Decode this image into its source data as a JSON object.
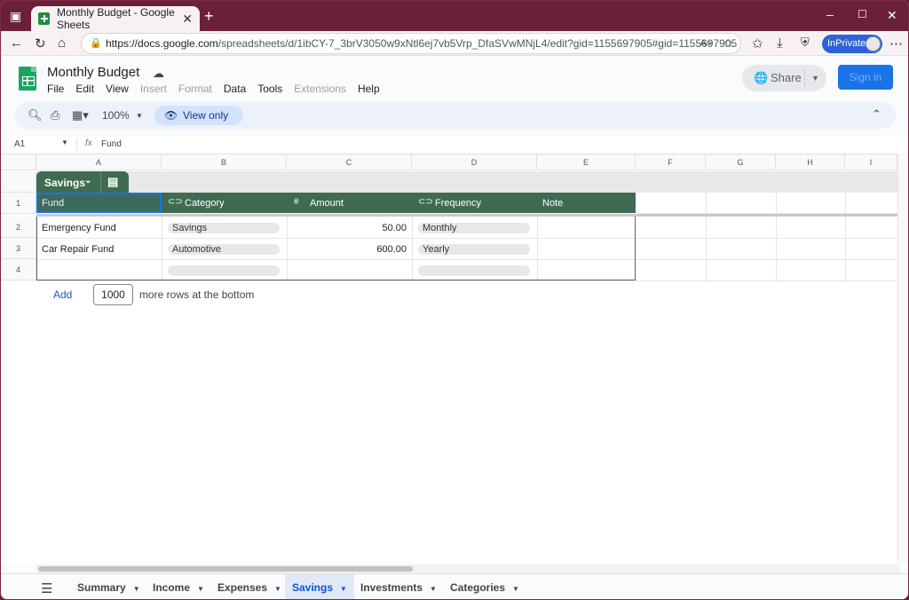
{
  "browser": {
    "tab_title": "Monthly Budget - Google Sheets",
    "url_host": "https://docs.google.com",
    "url_path": "/spreadsheets/d/1ibCY-7_3brV3050w9xNtl6ej7vb5Vrp_DfaSVwMNjL4/edit?gid=1155697905#gid=1155697905",
    "inprivate_label": "InPrivate"
  },
  "doc": {
    "title": "Monthly Budget",
    "menu": [
      "File",
      "Edit",
      "View",
      "Insert",
      "Format",
      "Data",
      "Tools",
      "Extensions",
      "Help"
    ],
    "share_label": "Share",
    "signin_label": "Sign in"
  },
  "toolbar": {
    "zoom": "100%",
    "view_only_label": "View only"
  },
  "formula_bar": {
    "name_box": "A1",
    "fx": "fx",
    "value": "Fund"
  },
  "grid": {
    "columns": [
      "A",
      "B",
      "C",
      "D",
      "E",
      "F",
      "G",
      "H",
      "I"
    ],
    "rows": [
      "1",
      "2",
      "3",
      "4"
    ],
    "table_name": "Savings",
    "headers": [
      "Fund",
      "Category",
      "Amount",
      "Frequency",
      "Note"
    ],
    "data": [
      {
        "fund": "Emergency Fund",
        "category": "Savings",
        "amount": "50.00",
        "frequency": "Monthly",
        "note": ""
      },
      {
        "fund": "Car Repair Fund",
        "category": "Automotive",
        "amount": "600.00",
        "frequency": "Yearly",
        "note": ""
      },
      {
        "fund": "",
        "category": "",
        "amount": "",
        "frequency": "",
        "note": ""
      }
    ],
    "add_label": "Add",
    "add_rows_value": "1000",
    "add_rows_suffix": "more rows at the bottom"
  },
  "sheets": {
    "tabs": [
      "Summary",
      "Income",
      "Expenses",
      "Savings",
      "Investments",
      "Categories"
    ],
    "active": "Savings"
  }
}
